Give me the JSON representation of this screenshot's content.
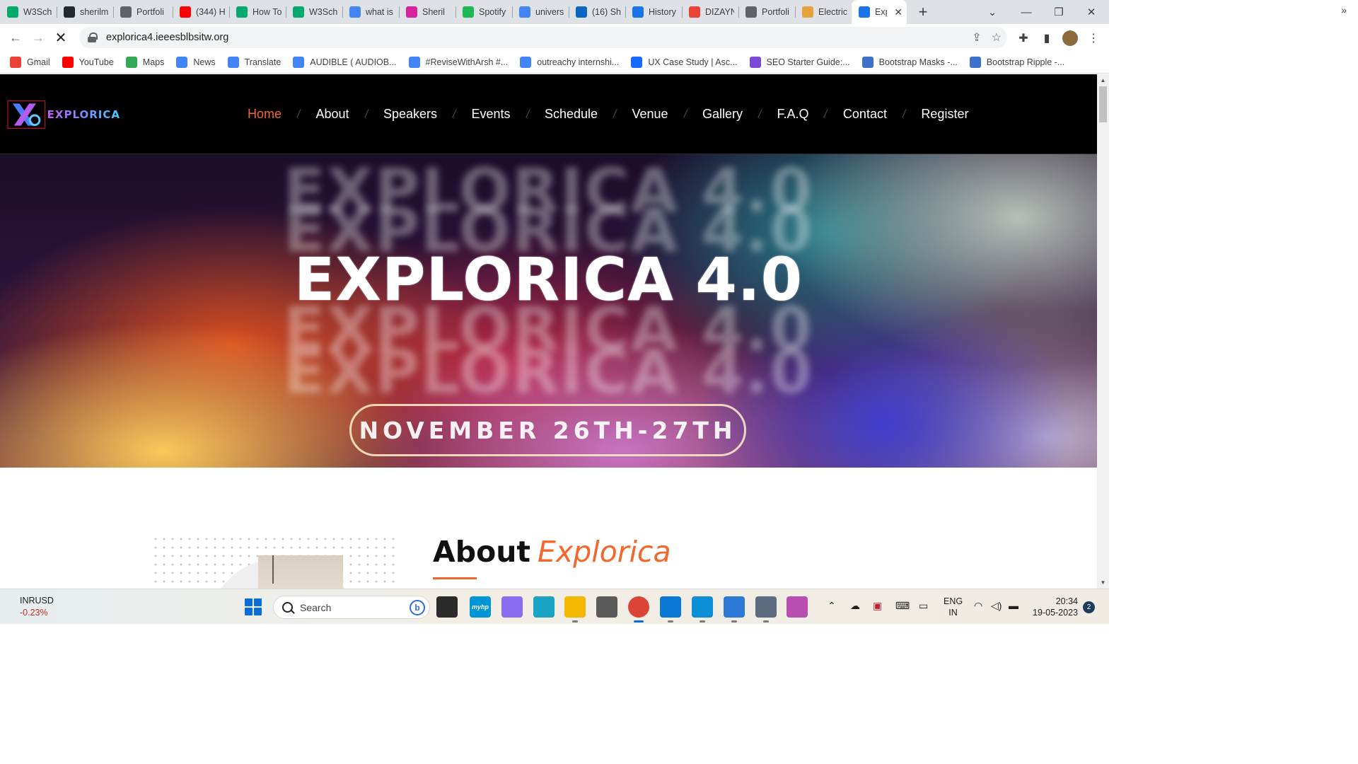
{
  "browser": {
    "tabs": [
      {
        "label": "W3Sch",
        "icon": "w3schools-icon",
        "color": "#04aa6d"
      },
      {
        "label": "sherilm",
        "icon": "github-icon",
        "color": "#24292f"
      },
      {
        "label": "Portfoli",
        "icon": "globe-icon",
        "color": "#5f6368"
      },
      {
        "label": "(344) H",
        "icon": "youtube-icon",
        "color": "#ff0000"
      },
      {
        "label": "How To",
        "icon": "w3schools-icon",
        "color": "#04aa6d"
      },
      {
        "label": "W3Sch",
        "icon": "w3schools-icon",
        "color": "#04aa6d"
      },
      {
        "label": "what is",
        "icon": "google-icon",
        "color": "#4285f4"
      },
      {
        "label": "Sheril",
        "icon": "instagram-icon",
        "color": "#d6249f"
      },
      {
        "label": "Spotify",
        "icon": "spotify-icon",
        "color": "#1db954"
      },
      {
        "label": "univers",
        "icon": "google-icon",
        "color": "#4285f4"
      },
      {
        "label": "(16) Sh",
        "icon": "linkedin-icon",
        "color": "#0a66c2"
      },
      {
        "label": "History",
        "icon": "history-icon",
        "color": "#1a73e8"
      },
      {
        "label": "DIZAYN",
        "icon": "gmail-icon",
        "color": "#ea4335"
      },
      {
        "label": "Portfoli",
        "icon": "globe-icon",
        "color": "#5f6368"
      },
      {
        "label": "Electric",
        "icon": "site-icon",
        "color": "#e6a23c"
      },
      {
        "label": "Exp",
        "icon": "loading-icon",
        "color": "#1a73e8",
        "active": true
      }
    ],
    "url": "explorica4.ieeesblbsitw.org",
    "bookmarks": [
      {
        "label": "Gmail",
        "icon": "gmail-icon",
        "color": "#ea4335"
      },
      {
        "label": "YouTube",
        "icon": "youtube-icon",
        "color": "#ff0000"
      },
      {
        "label": "Maps",
        "icon": "maps-icon",
        "color": "#34a853"
      },
      {
        "label": "News",
        "icon": "news-icon",
        "color": "#4285f4"
      },
      {
        "label": "Translate",
        "icon": "translate-icon",
        "color": "#4285f4"
      },
      {
        "label": "AUDIBLE ( AUDIOB...",
        "icon": "docs-icon",
        "color": "#4285f4"
      },
      {
        "label": "#ReviseWithArsh #...",
        "icon": "docs-icon",
        "color": "#4285f4"
      },
      {
        "label": "outreachy internshi...",
        "icon": "google-icon",
        "color": "#4285f4"
      },
      {
        "label": "UX Case Study | Asc...",
        "icon": "behance-icon",
        "color": "#1769ff"
      },
      {
        "label": "SEO Starter Guide:...",
        "icon": "code-icon",
        "color": "#7b4bd6"
      },
      {
        "label": "Bootstrap Masks -...",
        "icon": "mdb-icon",
        "color": "#3b71ca"
      },
      {
        "label": "Bootstrap Ripple -...",
        "icon": "mdb-icon",
        "color": "#3b71ca"
      }
    ]
  },
  "site": {
    "logo_text": "EXPLORICA",
    "nav": [
      "Home",
      "About",
      "Speakers",
      "Events",
      "Schedule",
      "Venue",
      "Gallery",
      "F.A.Q",
      "Contact",
      "Register"
    ],
    "active_nav": "Home",
    "accent_color": "#f4672a",
    "hero": {
      "title": "EXPLORICA  4.0",
      "date": "NOVEMBER 26TH-27TH"
    },
    "about": {
      "heading_plain": "About",
      "heading_accent": "Explorica"
    }
  },
  "taskbar": {
    "ticker_symbol": "INRUSD",
    "ticker_change": "-0.23%",
    "search_placeholder": "Search",
    "apps": [
      {
        "name": "task-view-icon",
        "color": "#2b2b2b"
      },
      {
        "name": "myhp-icon",
        "color": "#0096d6",
        "label": "myhp"
      },
      {
        "name": "copilot-icon",
        "color": "#8a6cf0"
      },
      {
        "name": "alexa-icon",
        "color": "#1aa3c4"
      },
      {
        "name": "file-explorer-icon",
        "color": "#f5b800"
      },
      {
        "name": "camera-icon",
        "color": "#5a5a5a"
      },
      {
        "name": "chrome-icon",
        "color": "#db4437"
      },
      {
        "name": "vscode-icon",
        "color": "#0a78d4"
      },
      {
        "name": "edge-icon",
        "color": "#0d8fd8"
      },
      {
        "name": "notepad-icon",
        "color": "#2d7ad6"
      },
      {
        "name": "settings-icon",
        "color": "#5c6b80"
      },
      {
        "name": "store-icon",
        "color": "#b84fb0"
      }
    ],
    "lang_primary": "ENG",
    "lang_secondary": "IN",
    "time": "20:34",
    "date": "19-05-2023",
    "notification_count": "2"
  }
}
